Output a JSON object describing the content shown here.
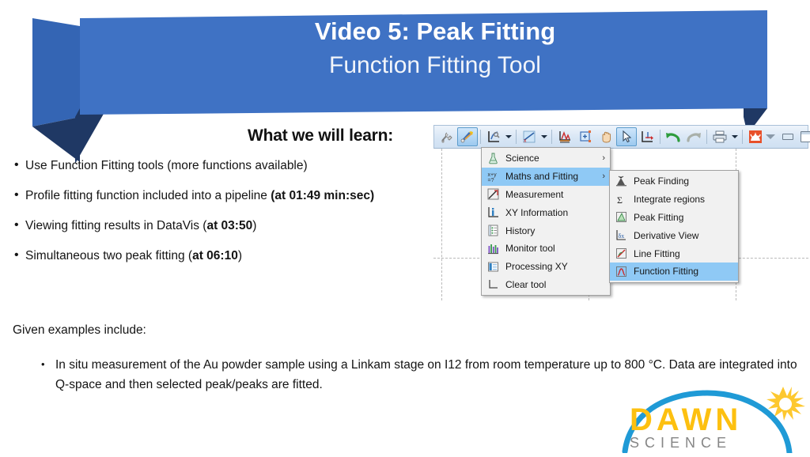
{
  "banner": {
    "title": "Video 5: Peak Fitting",
    "subtitle": "Function Fitting Tool",
    "color": "#3f72c4",
    "shadow_color": "#1f3864"
  },
  "headline": "What we will learn:",
  "bullets": [
    {
      "marker": "•",
      "text": "Use Function Fitting tools (more functions available)",
      "bold": ""
    },
    {
      "marker": "•",
      "text": "Profile fitting function included into a pipeline ",
      "bold": "(at 01:49 min:sec)"
    },
    {
      "marker": "•",
      "text": "Viewing fitting results in DataVis (",
      "bold": "at 03:50",
      "tail": ")"
    },
    {
      "marker": "•",
      "text": "Simultaneous two peak fitting (",
      "bold": "at 06:10",
      "tail": ")"
    }
  ],
  "given_examples_label": "Given examples include:",
  "example": {
    "marker": "•",
    "text": "In situ measurement of the Au powder sample using a Linkam stage on I12 from room temperature up to 800 °C. Data are integrated into Q-space and then selected peak/peaks are fitted."
  },
  "logo": {
    "word_primary": "DAWN",
    "word_secondary": "S C I E N C E",
    "primary_color": "#fdc010",
    "secondary_color": "#868686",
    "arc_color": "#1f9ad6",
    "sun_color": "#fdc82f"
  },
  "app": {
    "toolbar": {
      "items": [
        {
          "icon": "tools-wrench-icon",
          "selected": false
        },
        {
          "icon": "pencil-tools-icon",
          "selected": true
        },
        {
          "icon": "axis-config-icon",
          "selected": false
        },
        {
          "icon": "xy-plot-icon",
          "selected": false
        },
        {
          "icon": "peak-region-icon",
          "selected": false
        },
        {
          "icon": "zoom-box-icon",
          "selected": false
        },
        {
          "icon": "pan-hand-icon",
          "selected": false
        },
        {
          "icon": "cursor-arrow-icon",
          "selected": true
        },
        {
          "icon": "axis-arrow-icon",
          "selected": false
        },
        {
          "icon": "undo-icon",
          "selected": false
        },
        {
          "icon": "redo-icon",
          "selected": false
        },
        {
          "icon": "print-icon",
          "selected": false
        },
        {
          "icon": "snapshot-icon",
          "selected": false
        }
      ],
      "window_controls": [
        {
          "icon": "chevron-down-icon"
        },
        {
          "icon": "minimize-icon"
        },
        {
          "icon": "maximize-icon"
        }
      ]
    },
    "menu_main": {
      "items": [
        {
          "label": "Science",
          "icon": "flask-icon",
          "submenu": true,
          "highlighted": false
        },
        {
          "label": "Maths and Fitting",
          "icon": "xy-maths-icon",
          "submenu": true,
          "highlighted": true
        },
        {
          "label": "Measurement",
          "icon": "measurement-icon",
          "submenu": false,
          "highlighted": false
        },
        {
          "label": "XY Information",
          "icon": "info-icon",
          "submenu": false,
          "highlighted": false
        },
        {
          "label": "History",
          "icon": "history-icon",
          "submenu": false,
          "highlighted": false
        },
        {
          "label": "Monitor tool",
          "icon": "monitor-icon",
          "submenu": false,
          "highlighted": false
        },
        {
          "label": "Processing XY",
          "icon": "processing-icon",
          "submenu": false,
          "highlighted": false
        },
        {
          "label": "Clear tool",
          "icon": "clear-icon",
          "submenu": false,
          "highlighted": false
        }
      ]
    },
    "menu_sub": {
      "items": [
        {
          "label": "Peak Finding",
          "icon": "peak-finding-icon",
          "highlighted": false
        },
        {
          "label": "Integrate regions",
          "icon": "sigma-icon",
          "highlighted": false
        },
        {
          "label": "Peak Fitting",
          "icon": "peak-fitting-icon",
          "highlighted": false
        },
        {
          "label": "Derivative View",
          "icon": "derivative-icon",
          "highlighted": false
        },
        {
          "label": "Line Fitting",
          "icon": "line-fitting-icon",
          "highlighted": false
        },
        {
          "label": "Function Fitting",
          "icon": "function-fitting-icon",
          "highlighted": true
        }
      ]
    }
  }
}
